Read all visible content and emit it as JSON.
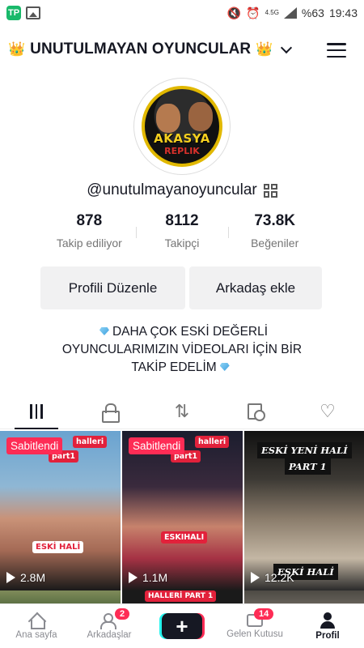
{
  "status_bar": {
    "app_icon_text": "TP",
    "network": "4.5G",
    "battery": "%63",
    "time": "19:43"
  },
  "header": {
    "crown": "👑",
    "title": "UNUTULMAYAN OYUNCULAR"
  },
  "avatar": {
    "line1": "AKASYA",
    "line2": "REPLIK"
  },
  "profile": {
    "handle": "@unutulmayanoyuncular"
  },
  "stats": [
    {
      "value": "878",
      "label": "Takip ediliyor"
    },
    {
      "value": "8112",
      "label": "Takipçi"
    },
    {
      "value": "73.8K",
      "label": "Beğeniler"
    }
  ],
  "buttons": {
    "edit_profile": "Profili Düzenle",
    "add_friend": "Arkadaş ekle"
  },
  "bio": {
    "line1": "DAHA ÇOK ESKİ DEĞERLİ",
    "line2": "OYUNCULARIMIZIN VİDEOLARI İÇİN BİR",
    "line3": "TAKİP EDELİM"
  },
  "videos": [
    {
      "pinned": "Sabitlendi",
      "sticker": "halleri",
      "sticker2": "part1",
      "caption": "ESKİ HALİ",
      "views": "2.8M"
    },
    {
      "pinned": "Sabitlendi",
      "sticker": "halleri",
      "sticker2": "part1",
      "caption": "ESKIHALI",
      "views": "1.1M"
    },
    {
      "caption_top": "ESKİ YENİ HALİ",
      "caption_top2": "PART 1",
      "caption": "ESKİ HALİ",
      "views": "12.2K"
    }
  ],
  "partial_row": {
    "sticker": "HALLERİ PART 1"
  },
  "nav": {
    "home": "Ana sayfa",
    "friends": "Arkadaşlar",
    "friends_badge": "2",
    "inbox": "Gelen Kutusu",
    "inbox_badge": "14",
    "profile": "Profil"
  },
  "colors": {
    "accent": "#fe2c55",
    "text": "#161823",
    "muted": "#757575"
  }
}
